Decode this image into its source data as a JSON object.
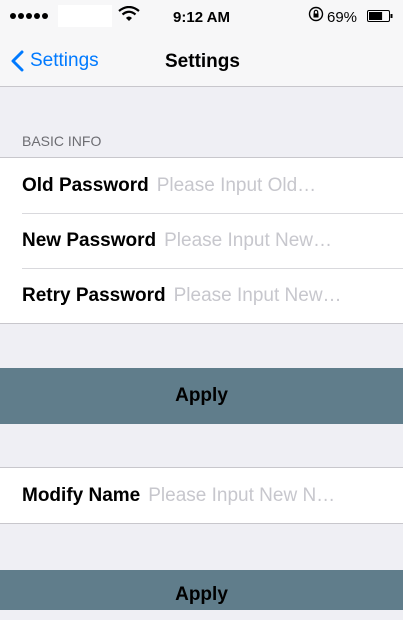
{
  "status_bar": {
    "time": "9:12 AM",
    "battery_percent": "69%",
    "battery_level": 0.69,
    "icons": [
      "signal-dots-icon",
      "wifi-icon",
      "orientation-lock-icon",
      "battery-icon"
    ]
  },
  "nav": {
    "back_label": "Settings",
    "title": "Settings"
  },
  "basic_info": {
    "header": "BASIC INFO",
    "rows": [
      {
        "label": "Old Password",
        "placeholder": "Please Input Old…"
      },
      {
        "label": "New Password",
        "placeholder": "Please Input New…"
      },
      {
        "label": "Retry Password",
        "placeholder": "Please Input New…"
      }
    ],
    "apply_label": "Apply"
  },
  "modify_name": {
    "label": "Modify Name",
    "placeholder": "Please Input New N…",
    "apply_label": "Apply"
  },
  "colors": {
    "accent": "#007aff",
    "apply_button": "#607d8b",
    "background": "#efeff4",
    "placeholder": "#c7c7cd"
  }
}
